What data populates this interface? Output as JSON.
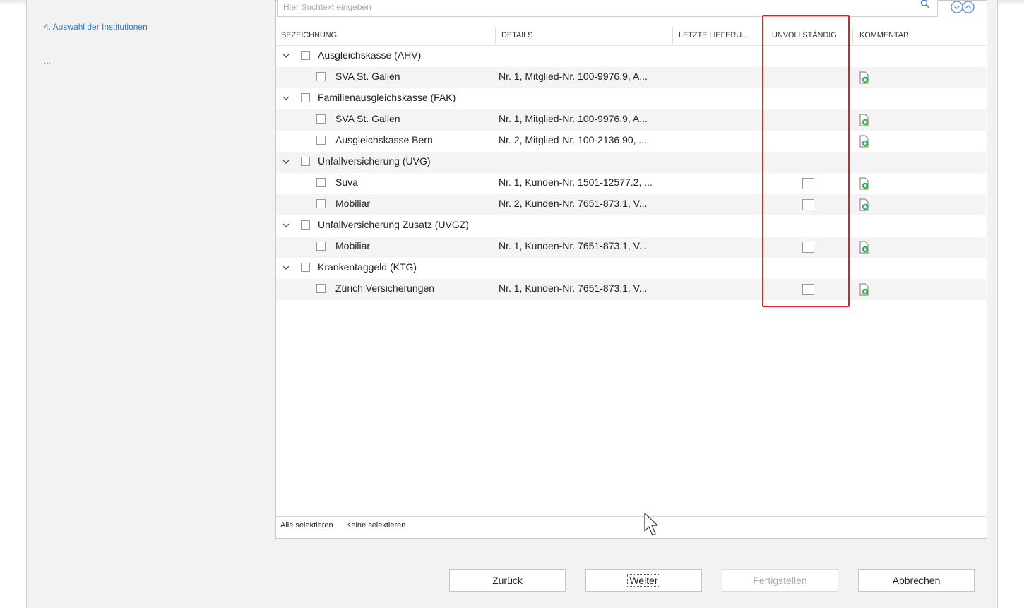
{
  "left": {
    "step_label": "4. Auswahl der Institutionen",
    "more_label": "..."
  },
  "search": {
    "placeholder": "Hier Suchtext eingeben"
  },
  "columns": {
    "bezeichnung": "BEZEICHNUNG",
    "details": "DETAILS",
    "letzte": "LETZTE LIEFERU...",
    "unvollstaendig": "UNVOLLSTÄNDIG",
    "kommentar": "KOMMENTAR"
  },
  "rows": [
    {
      "type": "group",
      "label": "Ausgleichskasse (AHV)"
    },
    {
      "type": "item",
      "label": "SVA St. Gallen",
      "details": "Nr. 1, Mitglied-Nr. 100-9976.9, A...",
      "unvollstaendig": false,
      "comment_icon": "add-comment-icon"
    },
    {
      "type": "group",
      "label": "Familienausgleichskasse (FAK)"
    },
    {
      "type": "item",
      "label": "SVA St. Gallen",
      "details": "Nr. 1, Mitglied-Nr. 100-9976.9, A...",
      "unvollstaendig": false,
      "comment_icon": "add-comment-icon"
    },
    {
      "type": "item",
      "label": "Ausgleichskasse Bern",
      "details": "Nr. 2, Mitglied-Nr. 100-2136.90, ...",
      "unvollstaendig": false,
      "comment_icon": "add-comment-icon"
    },
    {
      "type": "group",
      "label": "Unfallversicherung (UVG)"
    },
    {
      "type": "item",
      "label": "Suva",
      "details": "Nr. 1, Kunden-Nr. 1501-12577.2, ...",
      "unvollstaendig": true,
      "comment_icon": "add-comment-icon"
    },
    {
      "type": "item",
      "label": "Mobiliar",
      "details": "Nr. 2, Kunden-Nr. 7651-873.1, V...",
      "unvollstaendig": true,
      "comment_icon": "add-comment-icon"
    },
    {
      "type": "group",
      "label": "Unfallversicherung Zusatz (UVGZ)"
    },
    {
      "type": "item",
      "label": "Mobiliar",
      "details": "Nr. 1, Kunden-Nr. 7651-873.1, V...",
      "unvollstaendig": true,
      "comment_icon": "add-comment-icon"
    },
    {
      "type": "group",
      "label": "Krankentaggeld (KTG)"
    },
    {
      "type": "item",
      "label": "Zürich Versicherungen",
      "details": "Nr. 1, Kunden-Nr. 7651-873.1, V...",
      "unvollstaendig": true,
      "comment_icon": "add-comment-icon"
    }
  ],
  "footer": {
    "select_all": "Alle selektieren",
    "select_none": "Keine selektieren"
  },
  "buttons": {
    "back": "Zurück",
    "next": "Weiter",
    "finish": "Fertigstellen",
    "cancel": "Abbrechen"
  },
  "colors": {
    "link_blue": "#2f7bd0",
    "highlight_red": "#e02020",
    "icon_green": "#2fa84f"
  }
}
